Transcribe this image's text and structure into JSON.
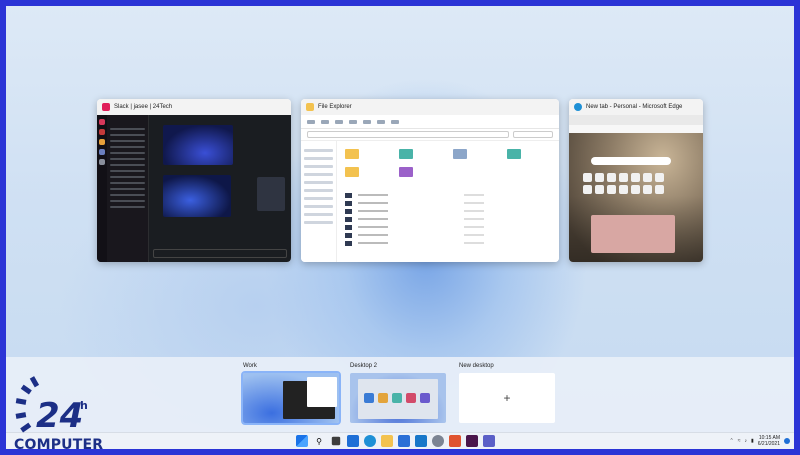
{
  "windows": [
    {
      "title": "Slack | jasee | 24Tech",
      "app": "slack"
    },
    {
      "title": "File Explorer",
      "app": "explorer"
    },
    {
      "title": "New tab - Personal - Microsoft Edge",
      "app": "edge"
    }
  ],
  "desktops": [
    {
      "label": "Work",
      "active": true
    },
    {
      "label": "Desktop 2",
      "active": false
    },
    {
      "label": "New desktop",
      "active": false
    }
  ],
  "new_desktop_plus": "+",
  "taskbar": {
    "icons": [
      "windows-icon",
      "search-icon",
      "task-view-icon",
      "widgets-icon",
      "edge-icon",
      "file-explorer-icon",
      "store-icon",
      "mail-icon",
      "settings-icon",
      "office-icon",
      "slack-icon",
      "teams-icon"
    ],
    "clock_time": "10:15 AM",
    "clock_date": "6/21/2021"
  },
  "logo": {
    "number": "24",
    "superscript": "h",
    "wordmark": "COMPUTER"
  },
  "colors": {
    "border": "#2b34d6",
    "logo_blue": "#1c2f86",
    "active_outline": "#8ab4f8"
  }
}
